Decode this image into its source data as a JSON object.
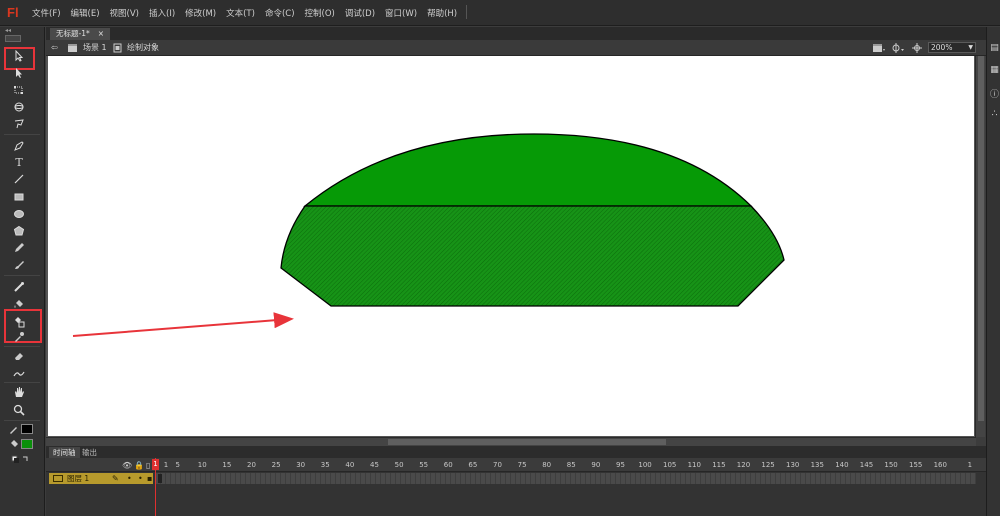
{
  "app": {
    "logo": "Fl"
  },
  "menu": [
    "文件(F)",
    "编辑(E)",
    "视图(V)",
    "插入(I)",
    "修改(M)",
    "文本(T)",
    "命令(C)",
    "控制(O)",
    "调试(D)",
    "窗口(W)",
    "帮助(H)"
  ],
  "document": {
    "tab_title": "无标题-1*",
    "tab_close": "×"
  },
  "editbar": {
    "back_arrow": "⇦",
    "scene": "场景 1",
    "object": "绘制对象",
    "zoom": "200%"
  },
  "colors": {
    "stroke": "#000000",
    "fill": "#0a8f0a",
    "shape_top": "#069a06",
    "shape_bottom": "#179317",
    "annotation": "#e8343a"
  },
  "timeline": {
    "tabs": [
      "时间轴",
      "输出"
    ],
    "layer_name": "图层 1",
    "current_frame": "1",
    "ruler_labels": [
      "1",
      "5",
      "10",
      "15",
      "20",
      "25",
      "30",
      "35",
      "40",
      "45",
      "50",
      "55",
      "60",
      "65",
      "70",
      "75",
      "80",
      "85",
      "90",
      "95",
      "100",
      "105",
      "110",
      "115",
      "120",
      "125",
      "130",
      "135",
      "140",
      "145",
      "150",
      "155",
      "160",
      "1"
    ]
  },
  "tools": [
    "selection-tool",
    "subselection-tool",
    "free-transform-tool",
    "3d-rotation-tool",
    "lasso-tool",
    "pen-tool",
    "text-tool",
    "line-tool",
    "rectangle-tool",
    "oval-tool",
    "polystar-tool",
    "pencil-tool",
    "brush-tool",
    "bone-tool",
    "paint-bucket-tool",
    "ink-bottle-tool",
    "eyedropper-tool",
    "eraser-tool",
    "width-tool",
    "hand-tool",
    "zoom-tool"
  ],
  "tool_glyphs": {
    "text": "T"
  }
}
